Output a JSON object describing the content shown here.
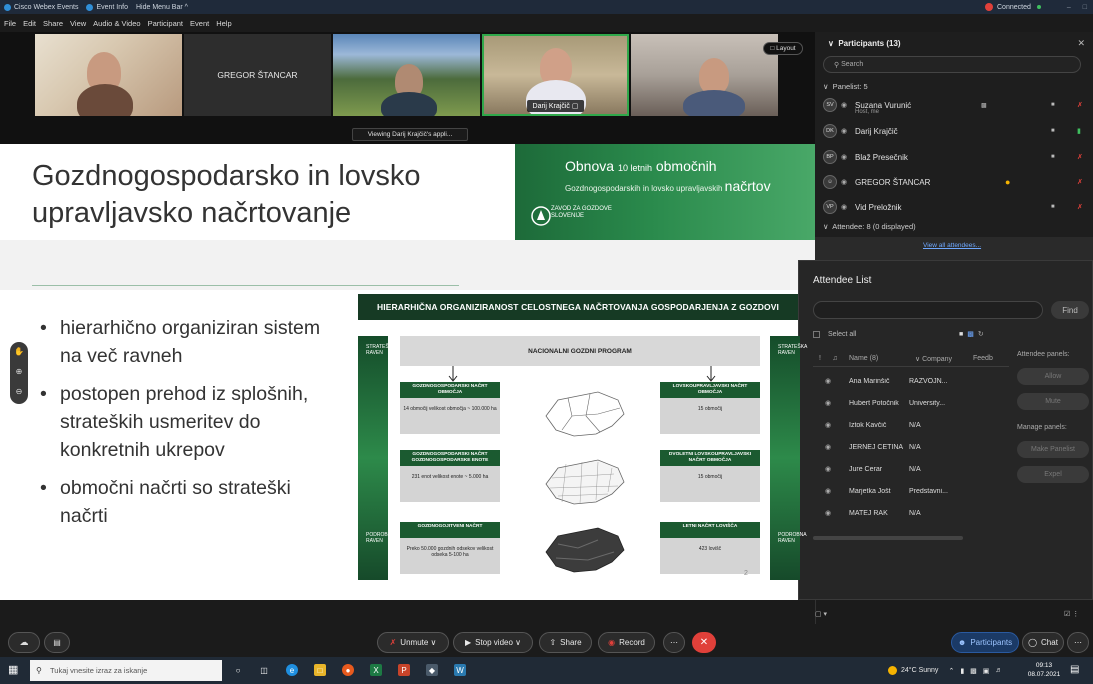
{
  "window": {
    "app_title": "Cisco Webex Events",
    "event_info": "Event Info",
    "hide_menu": "Hide Menu Bar ^",
    "status": "Connected",
    "win_controls": [
      "–",
      "□"
    ]
  },
  "menu": [
    "File",
    "Edit",
    "Share",
    "View",
    "Audio & Video",
    "Participant",
    "Event",
    "Help"
  ],
  "videos": {
    "tiles": [
      {
        "name": ""
      },
      {
        "name": "GREGOR ŠTANCAR"
      },
      {
        "name": ""
      },
      {
        "name": "Darij Krajčič"
      },
      {
        "name": ""
      }
    ],
    "layout_label": "Layout",
    "viewing_tooltip": "Viewing Darij Krajčič's appli..."
  },
  "slide": {
    "title": "Gozdnogospodarsko in lovsko upravljavsko načrtovanje",
    "banner": {
      "line1_a": "Obnova",
      "line1_b": "10 letnih",
      "line1_c": "območnih",
      "line2_a": "Gozdnogospodarskih in lovsko upravljavskih",
      "line2_b": "načrtov",
      "logo_text": "ZAVOD ZA GOZDOVE SLOVENIJE"
    },
    "bullets": [
      "hierarhično organiziran sistem na več ravneh",
      "postopen prehod iz splošnih, strateških usmeritev do konkretnih ukrepov",
      "območni načrti so strateški načrti"
    ],
    "diagram": {
      "header": "HIERARHIČNA ORGANIZIRANOST CELOSTNEGA NAČRTOVANJA GOSPODARJENJA Z GOZDOVI",
      "national": "NACIONALNI GOZDNI PROGRAM",
      "left_bar_top": "STRATEŠKA RAVEN",
      "left_bar_bottom": "PODROBNA RAVEN",
      "right_bar_top": "STRATEŠKA RAVEN",
      "right_bar_bottom": "PODROBNA RAVEN",
      "boxes_left": [
        {
          "header": "GOZDNOGOSPODARSKI NAČRT OBMOČJA",
          "body": "14 območij velikost območja ~ 100.000 ha"
        },
        {
          "header": "GOZDNOGOSPODARSKI NAČRT GOZDNOGOSPODARSKE ENOTE",
          "body": "231 enot velikost enote ~ 5.000 ha"
        },
        {
          "header": "GOZDNOGOJITVENI NAČRT",
          "body": "Preko 50.000 gozdnih odsekov velikost odseka 5-100 ha"
        }
      ],
      "boxes_right": [
        {
          "header": "LOVSKOUPRAVLJAVSKI NAČRT OBMOČJA",
          "body": "15 območij"
        },
        {
          "header": "DVOLETNI LOVSKOUPRAVLJAVSKI NAČRT OBMOČJA",
          "body": "15 območij"
        },
        {
          "header": "LETNI NAČRT LOVIŠČA",
          "body": "423 lovišč"
        }
      ],
      "page_number": "2"
    }
  },
  "participants_panel": {
    "title": "Participants (13)",
    "search_placeholder": "Search",
    "panelist_header": "Panelist: 5",
    "panelists": [
      {
        "initials": "SV",
        "name": "Suzana Vurunić",
        "sub": "Host, me"
      },
      {
        "initials": "DK",
        "name": "Darij Krajčič",
        "sub": ""
      },
      {
        "initials": "BP",
        "name": "Blaž Presečnik",
        "sub": ""
      },
      {
        "initials": "",
        "name": "GREGOR ŠTANCAR",
        "sub": ""
      },
      {
        "initials": "VP",
        "name": "Vid Preložnik",
        "sub": ""
      }
    ],
    "attendee_header": "Attendee: 8 (0 displayed)",
    "view_all": "View all attendees..."
  },
  "attendee_list": {
    "title": "Attendee List",
    "find_label": "Find",
    "select_all": "Select all",
    "col_name": "Name (8)",
    "col_company": "Company",
    "col_feedback": "Feedb",
    "rows": [
      {
        "name": "Ana Marinšič",
        "company": "RAZVOJN..."
      },
      {
        "name": "Hubert Potočnik",
        "company": "University..."
      },
      {
        "name": "Iztok Kavčič",
        "company": "N/A"
      },
      {
        "name": "JERNEJ ČETINA",
        "company": "N/A"
      },
      {
        "name": "Jure Cerar",
        "company": "N/A"
      },
      {
        "name": "Marjetka Jošt",
        "company": "Predstavni..."
      },
      {
        "name": "MATEJ RAK",
        "company": "N/A"
      }
    ],
    "attendee_panels_label": "Attendee panels:",
    "allow_label": "Allow",
    "mute_label": "Mute",
    "manage_panels_label": "Manage panels:",
    "make_panelist_label": "Make Panelist",
    "expel_label": "Expel"
  },
  "controls": {
    "unmute": "Unmute",
    "stop_video": "Stop video",
    "share": "Share",
    "record": "Record",
    "participants": "Participants",
    "chat": "Chat"
  },
  "taskbar": {
    "search_placeholder": "Tukaj vnesite izraz za iskanje",
    "weather": "24°C Sunny",
    "time": "09:13",
    "date": "08.07.2021"
  },
  "colors": {
    "accent_green": "#2fa84a",
    "banner_green": "#1d6a39",
    "record_red": "#e0403a"
  }
}
